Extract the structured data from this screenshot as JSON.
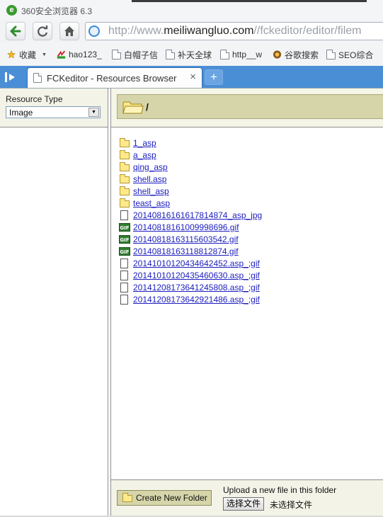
{
  "window": {
    "app_title": "360安全浏览器 6.3"
  },
  "address": {
    "url_prefix": "http://www.",
    "url_domain": "meiliwangluo.com",
    "url_path": "//fckeditor/editor/filem"
  },
  "bookmarks": [
    {
      "label": "收藏",
      "icon": "star-add-icon"
    },
    {
      "label": "hao123_",
      "icon": "hao123-icon"
    },
    {
      "label": "白帽子信",
      "icon": "page-icon"
    },
    {
      "label": "补天全球",
      "icon": "page-icon"
    },
    {
      "label": "http__w",
      "icon": "page-icon"
    },
    {
      "label": "谷歌搜索",
      "icon": "google-icon"
    },
    {
      "label": "SEO综合",
      "icon": "page-icon"
    }
  ],
  "tab": {
    "title": "FCKeditor - Resources Browser",
    "close": "×",
    "new_tab": "+"
  },
  "resource": {
    "label": "Resource Type",
    "selected": "Image"
  },
  "folder_path": "/",
  "files": [
    {
      "name": "1_asp",
      "kind": "folder"
    },
    {
      "name": "a_asp",
      "kind": "folder"
    },
    {
      "name": "qing_asp",
      "kind": "folder"
    },
    {
      "name": "shell.asp",
      "kind": "folder"
    },
    {
      "name": "shell_asp",
      "kind": "folder"
    },
    {
      "name": "teast_asp",
      "kind": "folder"
    },
    {
      "name": "20140816161617814874_asp_jpg",
      "kind": "file"
    },
    {
      "name": "20140818161009998696.gif",
      "kind": "gif"
    },
    {
      "name": "20140818163115603542.gif",
      "kind": "gif"
    },
    {
      "name": "20140818163118812874.gif",
      "kind": "gif"
    },
    {
      "name": "20141010120434642452.asp_;gif",
      "kind": "file"
    },
    {
      "name": "20141010120435460630.asp_;gif",
      "kind": "file"
    },
    {
      "name": "20141208173641245808.asp_;gif",
      "kind": "file"
    },
    {
      "name": "20141208173642921486.asp_;gif",
      "kind": "file"
    }
  ],
  "gif_badge": "GIF",
  "footer": {
    "create_folder": "Create New Folder",
    "upload_label": "Upload a new file in this folder",
    "choose_file": "选择文件",
    "no_file": "未选择文件"
  },
  "colors": {
    "tab_bar": "#4a8ed6",
    "panel": "#f3f3e8",
    "path_box": "#d6d5aa",
    "link": "#1d1dbf"
  }
}
